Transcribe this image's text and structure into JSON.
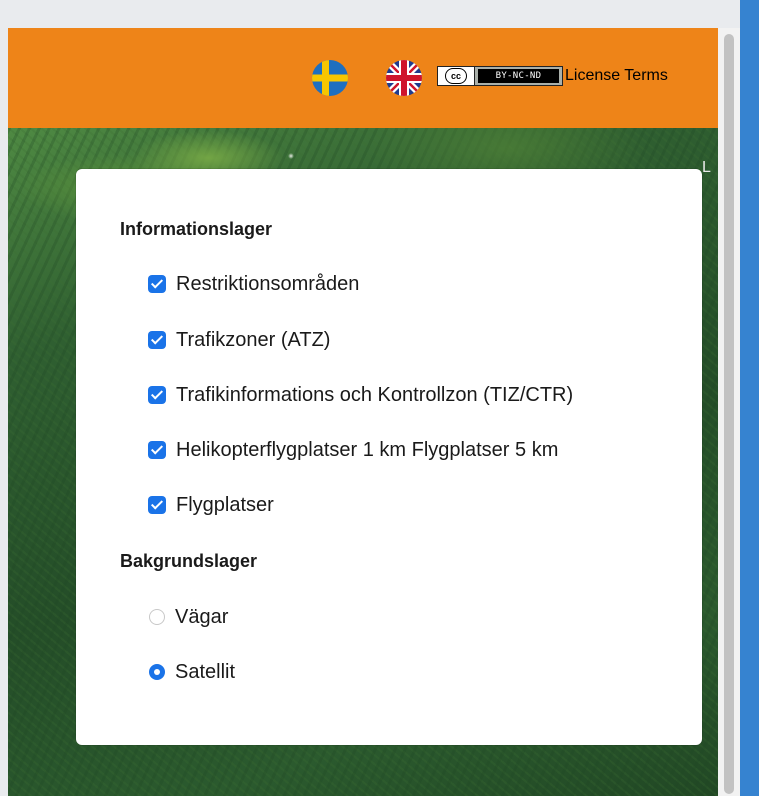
{
  "header": {
    "background": "#ee8418",
    "flags": [
      {
        "icon": "swedish-flag-icon"
      },
      {
        "icon": "uk-flag-icon"
      }
    ],
    "cc_badge": {
      "left": "cc",
      "right": "BY-NC-ND"
    },
    "license_label": "License Terms"
  },
  "map": {
    "edge_label": "L"
  },
  "panel": {
    "info_heading": "Informationslager",
    "info_layers": [
      {
        "label": "Restriktionsområden",
        "checked": true
      },
      {
        "label": "Trafikzoner (ATZ)",
        "checked": true
      },
      {
        "label": "Trafikinformations och Kontrollzon (TIZ/CTR)",
        "checked": true
      },
      {
        "label": "Helikopterflygplatser 1 km Flygplatser 5 km",
        "checked": true
      },
      {
        "label": "Flygplatser",
        "checked": true
      }
    ],
    "background_heading": "Bakgrundslager",
    "background_layers": [
      {
        "label": "Vägar",
        "selected": false
      },
      {
        "label": "Satellit",
        "selected": true
      }
    ]
  },
  "colors": {
    "accent": "#1a73e8",
    "right_bar": "#3683d0"
  }
}
